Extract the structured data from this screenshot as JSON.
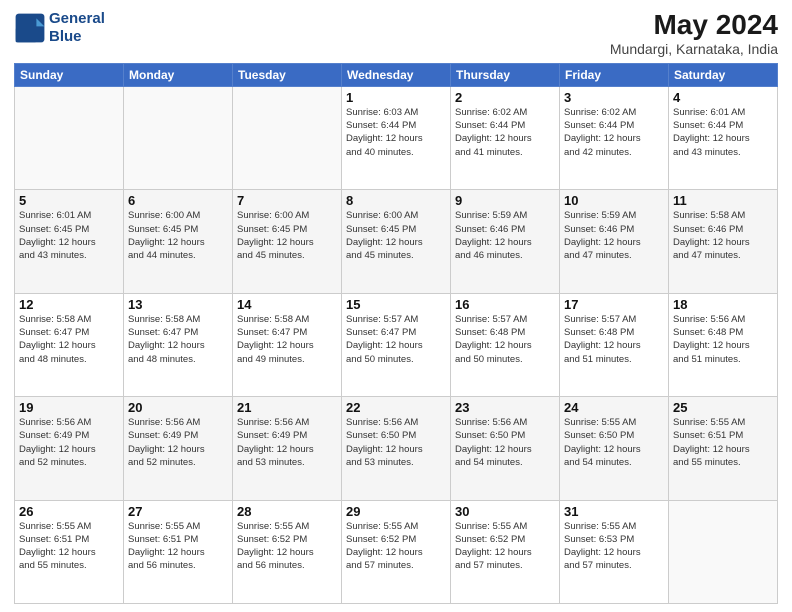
{
  "header": {
    "logo_line1": "General",
    "logo_line2": "Blue",
    "month_year": "May 2024",
    "location": "Mundargi, Karnataka, India"
  },
  "weekdays": [
    "Sunday",
    "Monday",
    "Tuesday",
    "Wednesday",
    "Thursday",
    "Friday",
    "Saturday"
  ],
  "rows": [
    [
      {
        "num": "",
        "info": ""
      },
      {
        "num": "",
        "info": ""
      },
      {
        "num": "",
        "info": ""
      },
      {
        "num": "1",
        "info": "Sunrise: 6:03 AM\nSunset: 6:44 PM\nDaylight: 12 hours\nand 40 minutes."
      },
      {
        "num": "2",
        "info": "Sunrise: 6:02 AM\nSunset: 6:44 PM\nDaylight: 12 hours\nand 41 minutes."
      },
      {
        "num": "3",
        "info": "Sunrise: 6:02 AM\nSunset: 6:44 PM\nDaylight: 12 hours\nand 42 minutes."
      },
      {
        "num": "4",
        "info": "Sunrise: 6:01 AM\nSunset: 6:44 PM\nDaylight: 12 hours\nand 43 minutes."
      }
    ],
    [
      {
        "num": "5",
        "info": "Sunrise: 6:01 AM\nSunset: 6:45 PM\nDaylight: 12 hours\nand 43 minutes."
      },
      {
        "num": "6",
        "info": "Sunrise: 6:00 AM\nSunset: 6:45 PM\nDaylight: 12 hours\nand 44 minutes."
      },
      {
        "num": "7",
        "info": "Sunrise: 6:00 AM\nSunset: 6:45 PM\nDaylight: 12 hours\nand 45 minutes."
      },
      {
        "num": "8",
        "info": "Sunrise: 6:00 AM\nSunset: 6:45 PM\nDaylight: 12 hours\nand 45 minutes."
      },
      {
        "num": "9",
        "info": "Sunrise: 5:59 AM\nSunset: 6:46 PM\nDaylight: 12 hours\nand 46 minutes."
      },
      {
        "num": "10",
        "info": "Sunrise: 5:59 AM\nSunset: 6:46 PM\nDaylight: 12 hours\nand 47 minutes."
      },
      {
        "num": "11",
        "info": "Sunrise: 5:58 AM\nSunset: 6:46 PM\nDaylight: 12 hours\nand 47 minutes."
      }
    ],
    [
      {
        "num": "12",
        "info": "Sunrise: 5:58 AM\nSunset: 6:47 PM\nDaylight: 12 hours\nand 48 minutes."
      },
      {
        "num": "13",
        "info": "Sunrise: 5:58 AM\nSunset: 6:47 PM\nDaylight: 12 hours\nand 48 minutes."
      },
      {
        "num": "14",
        "info": "Sunrise: 5:58 AM\nSunset: 6:47 PM\nDaylight: 12 hours\nand 49 minutes."
      },
      {
        "num": "15",
        "info": "Sunrise: 5:57 AM\nSunset: 6:47 PM\nDaylight: 12 hours\nand 50 minutes."
      },
      {
        "num": "16",
        "info": "Sunrise: 5:57 AM\nSunset: 6:48 PM\nDaylight: 12 hours\nand 50 minutes."
      },
      {
        "num": "17",
        "info": "Sunrise: 5:57 AM\nSunset: 6:48 PM\nDaylight: 12 hours\nand 51 minutes."
      },
      {
        "num": "18",
        "info": "Sunrise: 5:56 AM\nSunset: 6:48 PM\nDaylight: 12 hours\nand 51 minutes."
      }
    ],
    [
      {
        "num": "19",
        "info": "Sunrise: 5:56 AM\nSunset: 6:49 PM\nDaylight: 12 hours\nand 52 minutes."
      },
      {
        "num": "20",
        "info": "Sunrise: 5:56 AM\nSunset: 6:49 PM\nDaylight: 12 hours\nand 52 minutes."
      },
      {
        "num": "21",
        "info": "Sunrise: 5:56 AM\nSunset: 6:49 PM\nDaylight: 12 hours\nand 53 minutes."
      },
      {
        "num": "22",
        "info": "Sunrise: 5:56 AM\nSunset: 6:50 PM\nDaylight: 12 hours\nand 53 minutes."
      },
      {
        "num": "23",
        "info": "Sunrise: 5:56 AM\nSunset: 6:50 PM\nDaylight: 12 hours\nand 54 minutes."
      },
      {
        "num": "24",
        "info": "Sunrise: 5:55 AM\nSunset: 6:50 PM\nDaylight: 12 hours\nand 54 minutes."
      },
      {
        "num": "25",
        "info": "Sunrise: 5:55 AM\nSunset: 6:51 PM\nDaylight: 12 hours\nand 55 minutes."
      }
    ],
    [
      {
        "num": "26",
        "info": "Sunrise: 5:55 AM\nSunset: 6:51 PM\nDaylight: 12 hours\nand 55 minutes."
      },
      {
        "num": "27",
        "info": "Sunrise: 5:55 AM\nSunset: 6:51 PM\nDaylight: 12 hours\nand 56 minutes."
      },
      {
        "num": "28",
        "info": "Sunrise: 5:55 AM\nSunset: 6:52 PM\nDaylight: 12 hours\nand 56 minutes."
      },
      {
        "num": "29",
        "info": "Sunrise: 5:55 AM\nSunset: 6:52 PM\nDaylight: 12 hours\nand 57 minutes."
      },
      {
        "num": "30",
        "info": "Sunrise: 5:55 AM\nSunset: 6:52 PM\nDaylight: 12 hours\nand 57 minutes."
      },
      {
        "num": "31",
        "info": "Sunrise: 5:55 AM\nSunset: 6:53 PM\nDaylight: 12 hours\nand 57 minutes."
      },
      {
        "num": "",
        "info": ""
      }
    ]
  ]
}
